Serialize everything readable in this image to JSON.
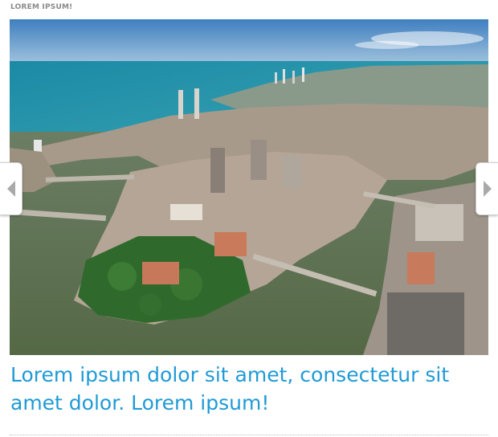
{
  "slider": {
    "kicker": "LOREM IPSUM!",
    "headline": "Lorem ipsum dolor sit amet, consectetur sit amet dolor. Lorem ipsum!",
    "image_alt": "Aerial photograph of a coastal city built on islands between rivers and the sea",
    "prev_icon": "chevron-left-icon",
    "next_icon": "chevron-right-icon"
  },
  "colors": {
    "headline": "#1f9ad6",
    "kicker": "#8a8a8a",
    "nav_arrow": "#a9a9a9"
  }
}
